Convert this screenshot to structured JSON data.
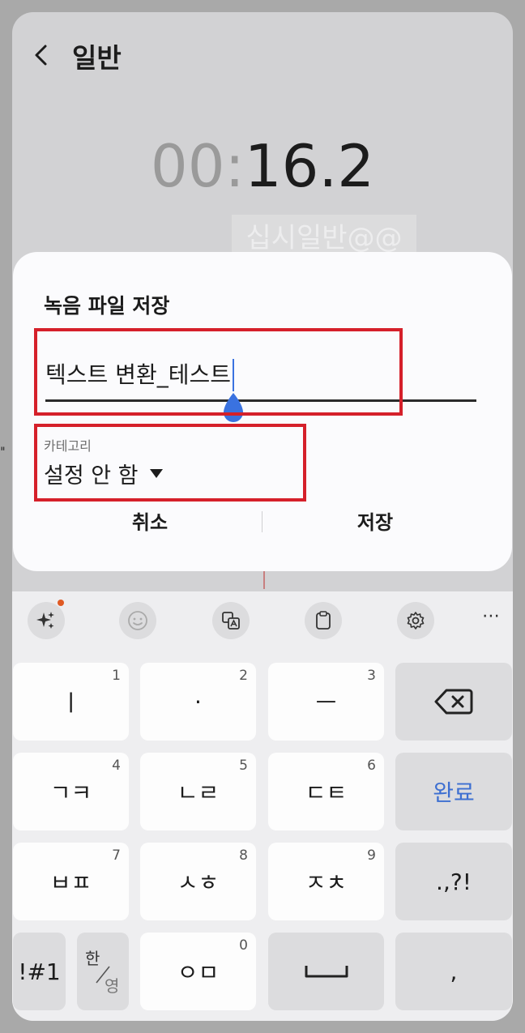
{
  "screen": {
    "title": "일반",
    "timer_dim": "00:",
    "timer_main": "16.2",
    "watermark": "십시일반@@"
  },
  "dialog": {
    "title": "녹음 파일 저장",
    "filename": "텍스트 변환_테스트",
    "category_label": "카테고리",
    "category_value": "설정 안 함",
    "cancel_label": "취소",
    "save_label": "저장"
  },
  "toolbar": {
    "icons": [
      "ai-sparkle-icon",
      "emoji-icon",
      "translate-icon",
      "clipboard-icon",
      "settings-icon",
      "more-icon"
    ],
    "more_label": "⋯"
  },
  "keyboard": {
    "row1": [
      {
        "label": "ㅣ",
        "num": "1"
      },
      {
        "label": "·",
        "num": "2"
      },
      {
        "label": "ㅡ",
        "num": "3"
      }
    ],
    "row2": [
      {
        "label": "ㄱㅋ",
        "num": "4"
      },
      {
        "label": "ㄴㄹ",
        "num": "5"
      },
      {
        "label": "ㄷㅌ",
        "num": "6"
      }
    ],
    "done_label": "완료",
    "row3": [
      {
        "label": "ㅂㅍ",
        "num": "7"
      },
      {
        "label": "ㅅㅎ",
        "num": "8"
      },
      {
        "label": "ㅈㅊ",
        "num": "9"
      }
    ],
    "punct_label": ".,?!",
    "symbols_label": "!#1",
    "lang_top": "한",
    "lang_bottom": "영",
    "row4_key": {
      "label": "ㅇㅁ",
      "num": "0"
    },
    "comma_label": ","
  },
  "colors": {
    "highlight": "#d5202a",
    "accent": "#3d6fd1",
    "notification_dot": "#e05a24"
  }
}
